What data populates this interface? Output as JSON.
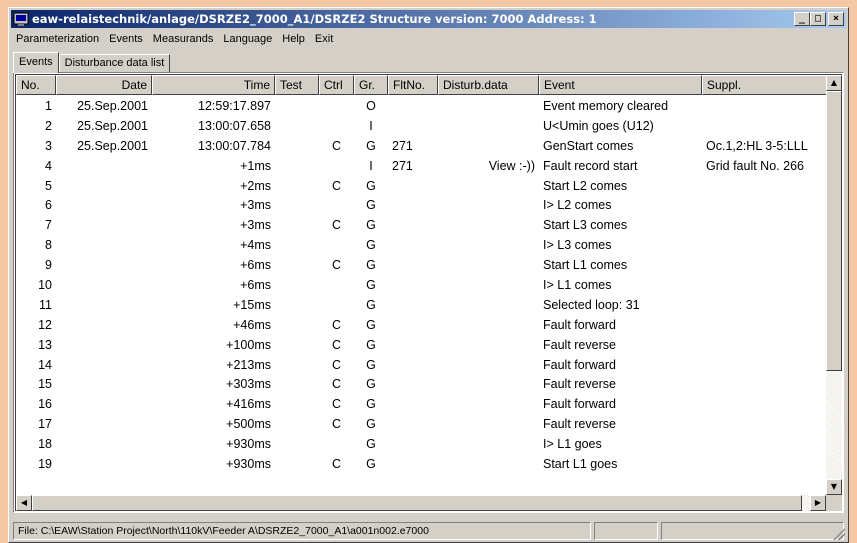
{
  "window": {
    "title": "eaw-relaistechnik/anlage/DSRZE2_7000_A1/DSRZE2 Structure version: 7000 Address: 1",
    "minimize": "_",
    "maximize": "□",
    "close": "×"
  },
  "menu": [
    "Parameterization",
    "Events",
    "Measurands",
    "Language",
    "Help",
    "Exit"
  ],
  "tabs": [
    "Events",
    "Disturbance data list"
  ],
  "columns": [
    "No.",
    "Date",
    "Time",
    "Test",
    "Ctrl",
    "Gr.",
    "FltNo.",
    "Disturb.data",
    "Event",
    "Suppl."
  ],
  "rows": [
    {
      "no": "1",
      "date": "25.Sep.2001",
      "time": "12:59:17.897",
      "test": "",
      "ctrl": "",
      "gr": "O",
      "flt": "",
      "dist": "",
      "event": "Event memory cleared",
      "suppl": ""
    },
    {
      "no": "2",
      "date": "25.Sep.2001",
      "time": "13:00:07.658",
      "test": "",
      "ctrl": "",
      "gr": "I",
      "flt": "",
      "dist": "",
      "event": "U<Umin goes (U12)",
      "suppl": ""
    },
    {
      "no": "3",
      "date": "25.Sep.2001",
      "time": "13:00:07.784",
      "test": "",
      "ctrl": "C",
      "gr": "G",
      "flt": "271",
      "dist": "",
      "event": "GenStart comes",
      "suppl": "Oc.1,2:HL 3-5:LLL"
    },
    {
      "no": "4",
      "date": "",
      "time": "+1ms",
      "test": "",
      "ctrl": "",
      "gr": "I",
      "flt": "271",
      "dist": "View :-))",
      "event": "Fault record start",
      "suppl": "Grid fault No. 266"
    },
    {
      "no": "5",
      "date": "",
      "time": "+2ms",
      "test": "",
      "ctrl": "C",
      "gr": "G",
      "flt": "",
      "dist": "",
      "event": "Start L2 comes",
      "suppl": ""
    },
    {
      "no": "6",
      "date": "",
      "time": "+3ms",
      "test": "",
      "ctrl": "",
      "gr": "G",
      "flt": "",
      "dist": "",
      "event": "I> L2 comes",
      "suppl": ""
    },
    {
      "no": "7",
      "date": "",
      "time": "+3ms",
      "test": "",
      "ctrl": "C",
      "gr": "G",
      "flt": "",
      "dist": "",
      "event": "Start L3 comes",
      "suppl": ""
    },
    {
      "no": "8",
      "date": "",
      "time": "+4ms",
      "test": "",
      "ctrl": "",
      "gr": "G",
      "flt": "",
      "dist": "",
      "event": "I> L3 comes",
      "suppl": ""
    },
    {
      "no": "9",
      "date": "",
      "time": "+6ms",
      "test": "",
      "ctrl": "C",
      "gr": "G",
      "flt": "",
      "dist": "",
      "event": "Start L1 comes",
      "suppl": ""
    },
    {
      "no": "10",
      "date": "",
      "time": "+6ms",
      "test": "",
      "ctrl": "",
      "gr": "G",
      "flt": "",
      "dist": "",
      "event": "I> L1 comes",
      "suppl": ""
    },
    {
      "no": "11",
      "date": "",
      "time": "+15ms",
      "test": "",
      "ctrl": "",
      "gr": "G",
      "flt": "",
      "dist": "",
      "event": "Selected loop: 31",
      "suppl": ""
    },
    {
      "no": "12",
      "date": "",
      "time": "+46ms",
      "test": "",
      "ctrl": "C",
      "gr": "G",
      "flt": "",
      "dist": "",
      "event": "Fault forward",
      "suppl": ""
    },
    {
      "no": "13",
      "date": "",
      "time": "+100ms",
      "test": "",
      "ctrl": "C",
      "gr": "G",
      "flt": "",
      "dist": "",
      "event": "Fault reverse",
      "suppl": ""
    },
    {
      "no": "14",
      "date": "",
      "time": "+213ms",
      "test": "",
      "ctrl": "C",
      "gr": "G",
      "flt": "",
      "dist": "",
      "event": "Fault forward",
      "suppl": ""
    },
    {
      "no": "15",
      "date": "",
      "time": "+303ms",
      "test": "",
      "ctrl": "C",
      "gr": "G",
      "flt": "",
      "dist": "",
      "event": "Fault reverse",
      "suppl": ""
    },
    {
      "no": "16",
      "date": "",
      "time": "+416ms",
      "test": "",
      "ctrl": "C",
      "gr": "G",
      "flt": "",
      "dist": "",
      "event": "Fault forward",
      "suppl": ""
    },
    {
      "no": "17",
      "date": "",
      "time": "+500ms",
      "test": "",
      "ctrl": "C",
      "gr": "G",
      "flt": "",
      "dist": "",
      "event": "Fault reverse",
      "suppl": ""
    },
    {
      "no": "18",
      "date": "",
      "time": "+930ms",
      "test": "",
      "ctrl": "",
      "gr": "G",
      "flt": "",
      "dist": "",
      "event": "I> L1 goes",
      "suppl": ""
    },
    {
      "no": "19",
      "date": "",
      "time": "+930ms",
      "test": "",
      "ctrl": "C",
      "gr": "G",
      "flt": "",
      "dist": "",
      "event": "Start L1 goes",
      "suppl": ""
    }
  ],
  "status": {
    "file": "File: C:\\EAW\\Station Project\\North\\110kV\\Feeder A\\DSRZE2_7000_A1\\a001n002.e7000",
    "panel2": "",
    "panel3": ""
  },
  "scrollbars": {
    "up_arrow": "▲",
    "down_arrow": "▼",
    "left_arrow": "◀",
    "right_arrow": "▶"
  }
}
